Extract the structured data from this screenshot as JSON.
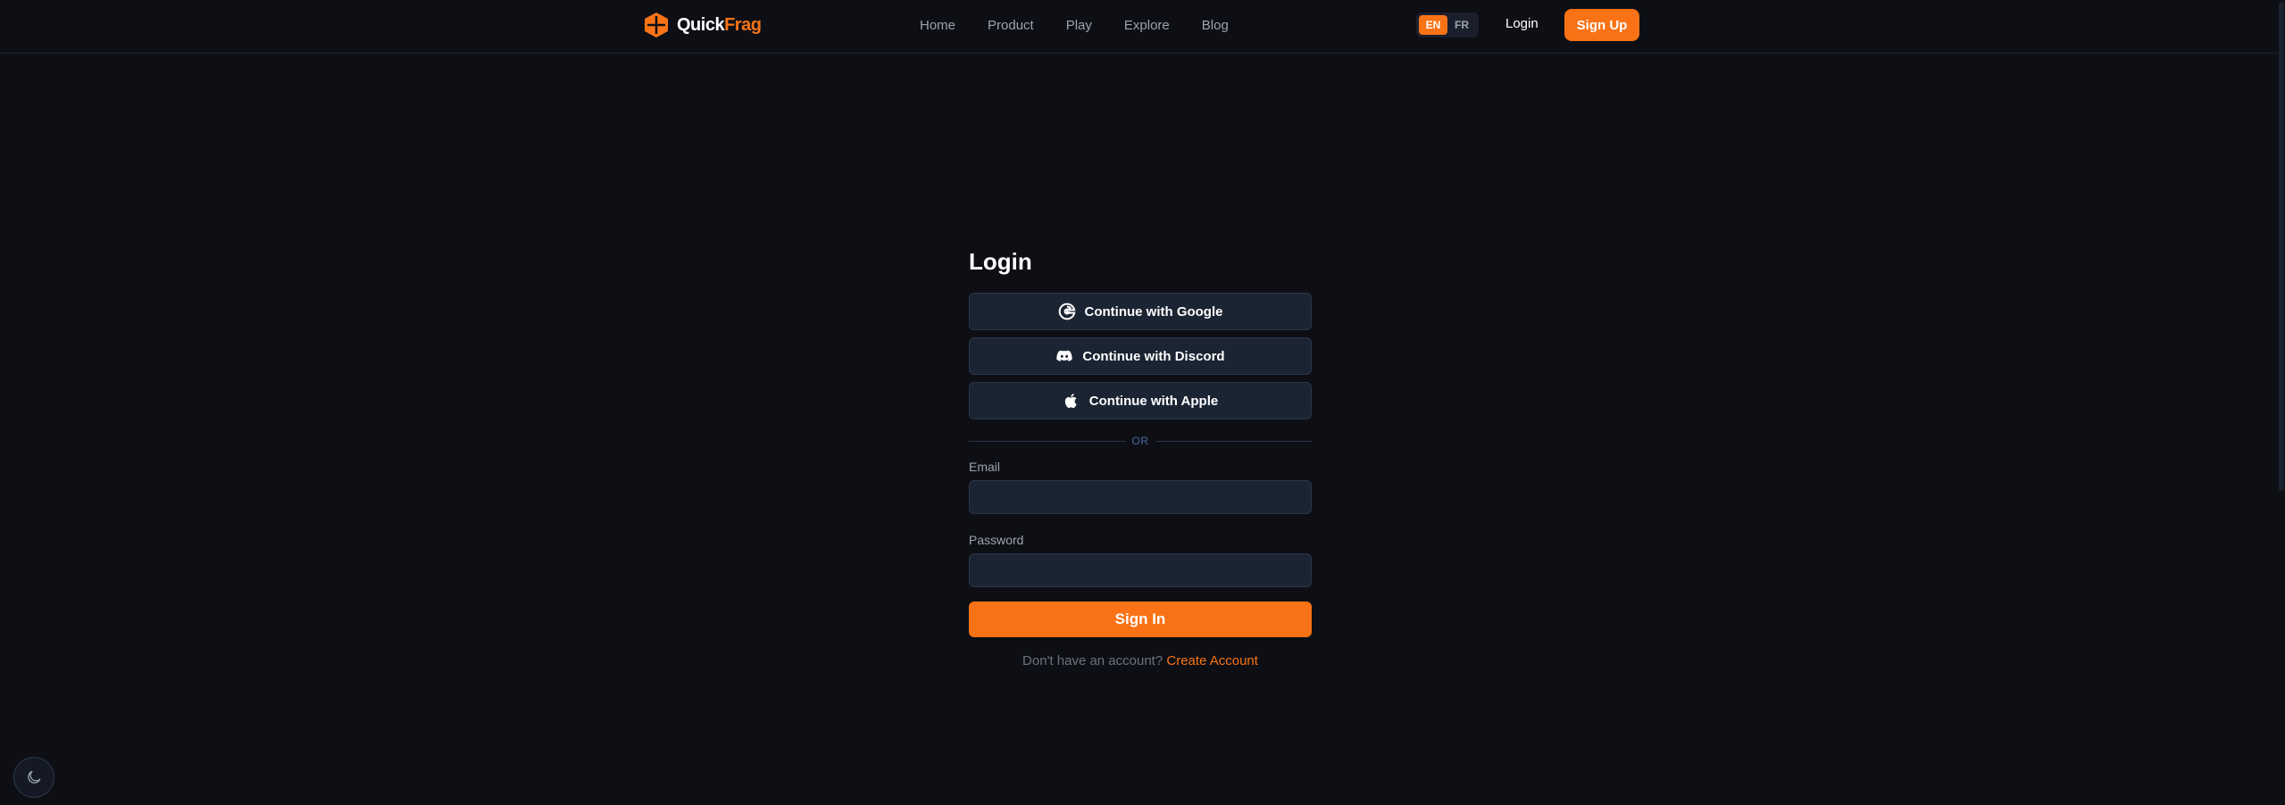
{
  "header": {
    "logo": {
      "part1": "Quick",
      "part2": "Frag"
    },
    "nav": [
      "Home",
      "Product",
      "Play",
      "Explore",
      "Blog"
    ],
    "languages": [
      {
        "code": "EN",
        "active": true
      },
      {
        "code": "FR",
        "active": false
      }
    ],
    "login_label": "Login",
    "signup_label": "Sign Up"
  },
  "login": {
    "title": "Login",
    "oauth": [
      {
        "label": "Continue with Google",
        "icon": "google-icon"
      },
      {
        "label": "Continue with Discord",
        "icon": "discord-icon"
      },
      {
        "label": "Continue with Apple",
        "icon": "apple-icon"
      }
    ],
    "divider": "OR",
    "email_label": "Email",
    "email_value": "",
    "password_label": "Password",
    "password_value": "",
    "signin_label": "Sign In",
    "no_account_text": "Don't have an account?",
    "create_account_label": "Create Account"
  },
  "theme": {
    "accent": "#f97316",
    "background": "#0d0f15",
    "surface": "#1b2433"
  }
}
